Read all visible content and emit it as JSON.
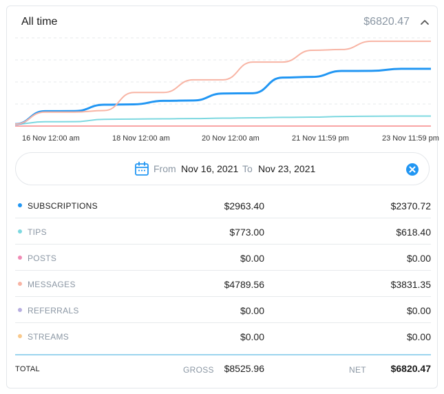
{
  "header": {
    "title": "All time",
    "total": "$6820.47"
  },
  "chart_data": {
    "type": "line",
    "x_labels": [
      "16 Nov 12:00 am",
      "18 Nov 12:00 am",
      "20 Nov 12:00 am",
      "21 Nov 11:59 pm",
      "23 Nov 11:59 pm"
    ],
    "ylim": [
      0,
      6820.47
    ],
    "grid": true,
    "series": [
      {
        "key": "messages",
        "color": "#f8b4a4",
        "values": [
          150,
          1080,
          1080,
          1200,
          2600,
          2600,
          3580,
          3580,
          4950,
          4950,
          5860,
          5920,
          6560,
          6560,
          6560
        ]
      },
      {
        "key": "subscriptions",
        "color": "#2196f3",
        "values": [
          150,
          1150,
          1160,
          1650,
          1680,
          1950,
          1980,
          2520,
          2540,
          3750,
          3800,
          4260,
          4270,
          4430,
          4430
        ]
      },
      {
        "key": "tips",
        "color": "#7dd8e0",
        "values": [
          150,
          330,
          340,
          520,
          540,
          560,
          580,
          610,
          640,
          670,
          690,
          740,
          760,
          773,
          773
        ]
      },
      {
        "key": "posts",
        "color": "#f8a4a4",
        "values": [
          0,
          0,
          0,
          0,
          0,
          0,
          0,
          0,
          0,
          0,
          0,
          0,
          0,
          0,
          0
        ]
      }
    ]
  },
  "range": {
    "from_label": "From",
    "from_value": "Nov 16, 2021",
    "to_label": "To",
    "to_value": "Nov 23, 2021",
    "calendar_icon": "calendar-icon",
    "clear_icon": "close-circle-icon"
  },
  "rows": [
    {
      "name": "SUBSCRIPTIONS",
      "gross": "$2963.40",
      "net": "$2370.72",
      "color": "#2196f3"
    },
    {
      "name": "TIPS",
      "gross": "$773.00",
      "net": "$618.40",
      "color": "#7dd8e0"
    },
    {
      "name": "POSTS",
      "gross": "$0.00",
      "net": "$0.00",
      "color": "#f08bb5"
    },
    {
      "name": "MESSAGES",
      "gross": "$4789.56",
      "net": "$3831.35",
      "color": "#f8b4a4"
    },
    {
      "name": "REFERRALS",
      "gross": "$0.00",
      "net": "$0.00",
      "color": "#b7aee0"
    },
    {
      "name": "STREAMS",
      "gross": "$0.00",
      "net": "$0.00",
      "color": "#f9c98c"
    }
  ],
  "total": {
    "label": "TOTAL",
    "gross_label": "GROSS",
    "gross_value": "$8525.96",
    "net_label": "NET",
    "net_value": "$6820.47"
  }
}
